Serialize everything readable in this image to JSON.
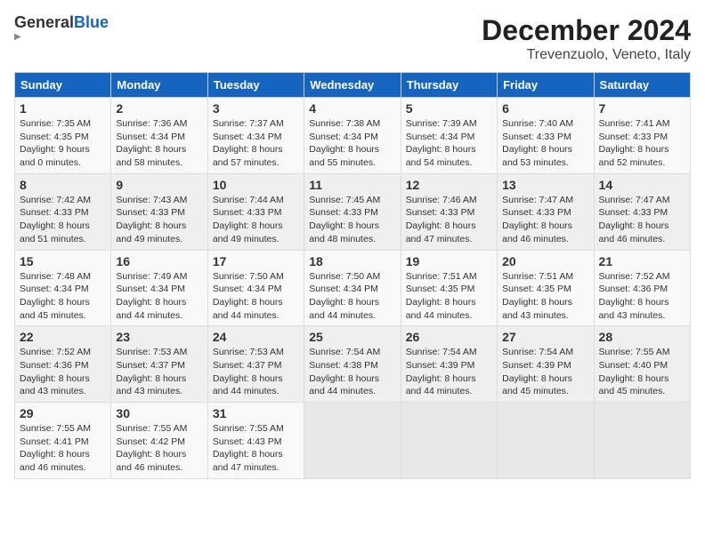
{
  "logo": {
    "line1": "General",
    "line2": "Blue"
  },
  "title": "December 2024",
  "subtitle": "Trevenzuolo, Veneto, Italy",
  "weekdays": [
    "Sunday",
    "Monday",
    "Tuesday",
    "Wednesday",
    "Thursday",
    "Friday",
    "Saturday"
  ],
  "weeks": [
    [
      {
        "day": 1,
        "info": "Sunrise: 7:35 AM\nSunset: 4:35 PM\nDaylight: 9 hours\nand 0 minutes."
      },
      {
        "day": 2,
        "info": "Sunrise: 7:36 AM\nSunset: 4:34 PM\nDaylight: 8 hours\nand 58 minutes."
      },
      {
        "day": 3,
        "info": "Sunrise: 7:37 AM\nSunset: 4:34 PM\nDaylight: 8 hours\nand 57 minutes."
      },
      {
        "day": 4,
        "info": "Sunrise: 7:38 AM\nSunset: 4:34 PM\nDaylight: 8 hours\nand 55 minutes."
      },
      {
        "day": 5,
        "info": "Sunrise: 7:39 AM\nSunset: 4:34 PM\nDaylight: 8 hours\nand 54 minutes."
      },
      {
        "day": 6,
        "info": "Sunrise: 7:40 AM\nSunset: 4:33 PM\nDaylight: 8 hours\nand 53 minutes."
      },
      {
        "day": 7,
        "info": "Sunrise: 7:41 AM\nSunset: 4:33 PM\nDaylight: 8 hours\nand 52 minutes."
      }
    ],
    [
      {
        "day": 8,
        "info": "Sunrise: 7:42 AM\nSunset: 4:33 PM\nDaylight: 8 hours\nand 51 minutes."
      },
      {
        "day": 9,
        "info": "Sunrise: 7:43 AM\nSunset: 4:33 PM\nDaylight: 8 hours\nand 49 minutes."
      },
      {
        "day": 10,
        "info": "Sunrise: 7:44 AM\nSunset: 4:33 PM\nDaylight: 8 hours\nand 49 minutes."
      },
      {
        "day": 11,
        "info": "Sunrise: 7:45 AM\nSunset: 4:33 PM\nDaylight: 8 hours\nand 48 minutes."
      },
      {
        "day": 12,
        "info": "Sunrise: 7:46 AM\nSunset: 4:33 PM\nDaylight: 8 hours\nand 47 minutes."
      },
      {
        "day": 13,
        "info": "Sunrise: 7:47 AM\nSunset: 4:33 PM\nDaylight: 8 hours\nand 46 minutes."
      },
      {
        "day": 14,
        "info": "Sunrise: 7:47 AM\nSunset: 4:33 PM\nDaylight: 8 hours\nand 46 minutes."
      }
    ],
    [
      {
        "day": 15,
        "info": "Sunrise: 7:48 AM\nSunset: 4:34 PM\nDaylight: 8 hours\nand 45 minutes."
      },
      {
        "day": 16,
        "info": "Sunrise: 7:49 AM\nSunset: 4:34 PM\nDaylight: 8 hours\nand 44 minutes."
      },
      {
        "day": 17,
        "info": "Sunrise: 7:50 AM\nSunset: 4:34 PM\nDaylight: 8 hours\nand 44 minutes."
      },
      {
        "day": 18,
        "info": "Sunrise: 7:50 AM\nSunset: 4:34 PM\nDaylight: 8 hours\nand 44 minutes."
      },
      {
        "day": 19,
        "info": "Sunrise: 7:51 AM\nSunset: 4:35 PM\nDaylight: 8 hours\nand 44 minutes."
      },
      {
        "day": 20,
        "info": "Sunrise: 7:51 AM\nSunset: 4:35 PM\nDaylight: 8 hours\nand 43 minutes."
      },
      {
        "day": 21,
        "info": "Sunrise: 7:52 AM\nSunset: 4:36 PM\nDaylight: 8 hours\nand 43 minutes."
      }
    ],
    [
      {
        "day": 22,
        "info": "Sunrise: 7:52 AM\nSunset: 4:36 PM\nDaylight: 8 hours\nand 43 minutes."
      },
      {
        "day": 23,
        "info": "Sunrise: 7:53 AM\nSunset: 4:37 PM\nDaylight: 8 hours\nand 43 minutes."
      },
      {
        "day": 24,
        "info": "Sunrise: 7:53 AM\nSunset: 4:37 PM\nDaylight: 8 hours\nand 44 minutes."
      },
      {
        "day": 25,
        "info": "Sunrise: 7:54 AM\nSunset: 4:38 PM\nDaylight: 8 hours\nand 44 minutes."
      },
      {
        "day": 26,
        "info": "Sunrise: 7:54 AM\nSunset: 4:39 PM\nDaylight: 8 hours\nand 44 minutes."
      },
      {
        "day": 27,
        "info": "Sunrise: 7:54 AM\nSunset: 4:39 PM\nDaylight: 8 hours\nand 45 minutes."
      },
      {
        "day": 28,
        "info": "Sunrise: 7:55 AM\nSunset: 4:40 PM\nDaylight: 8 hours\nand 45 minutes."
      }
    ],
    [
      {
        "day": 29,
        "info": "Sunrise: 7:55 AM\nSunset: 4:41 PM\nDaylight: 8 hours\nand 46 minutes."
      },
      {
        "day": 30,
        "info": "Sunrise: 7:55 AM\nSunset: 4:42 PM\nDaylight: 8 hours\nand 46 minutes."
      },
      {
        "day": 31,
        "info": "Sunrise: 7:55 AM\nSunset: 4:43 PM\nDaylight: 8 hours\nand 47 minutes."
      },
      null,
      null,
      null,
      null
    ]
  ]
}
